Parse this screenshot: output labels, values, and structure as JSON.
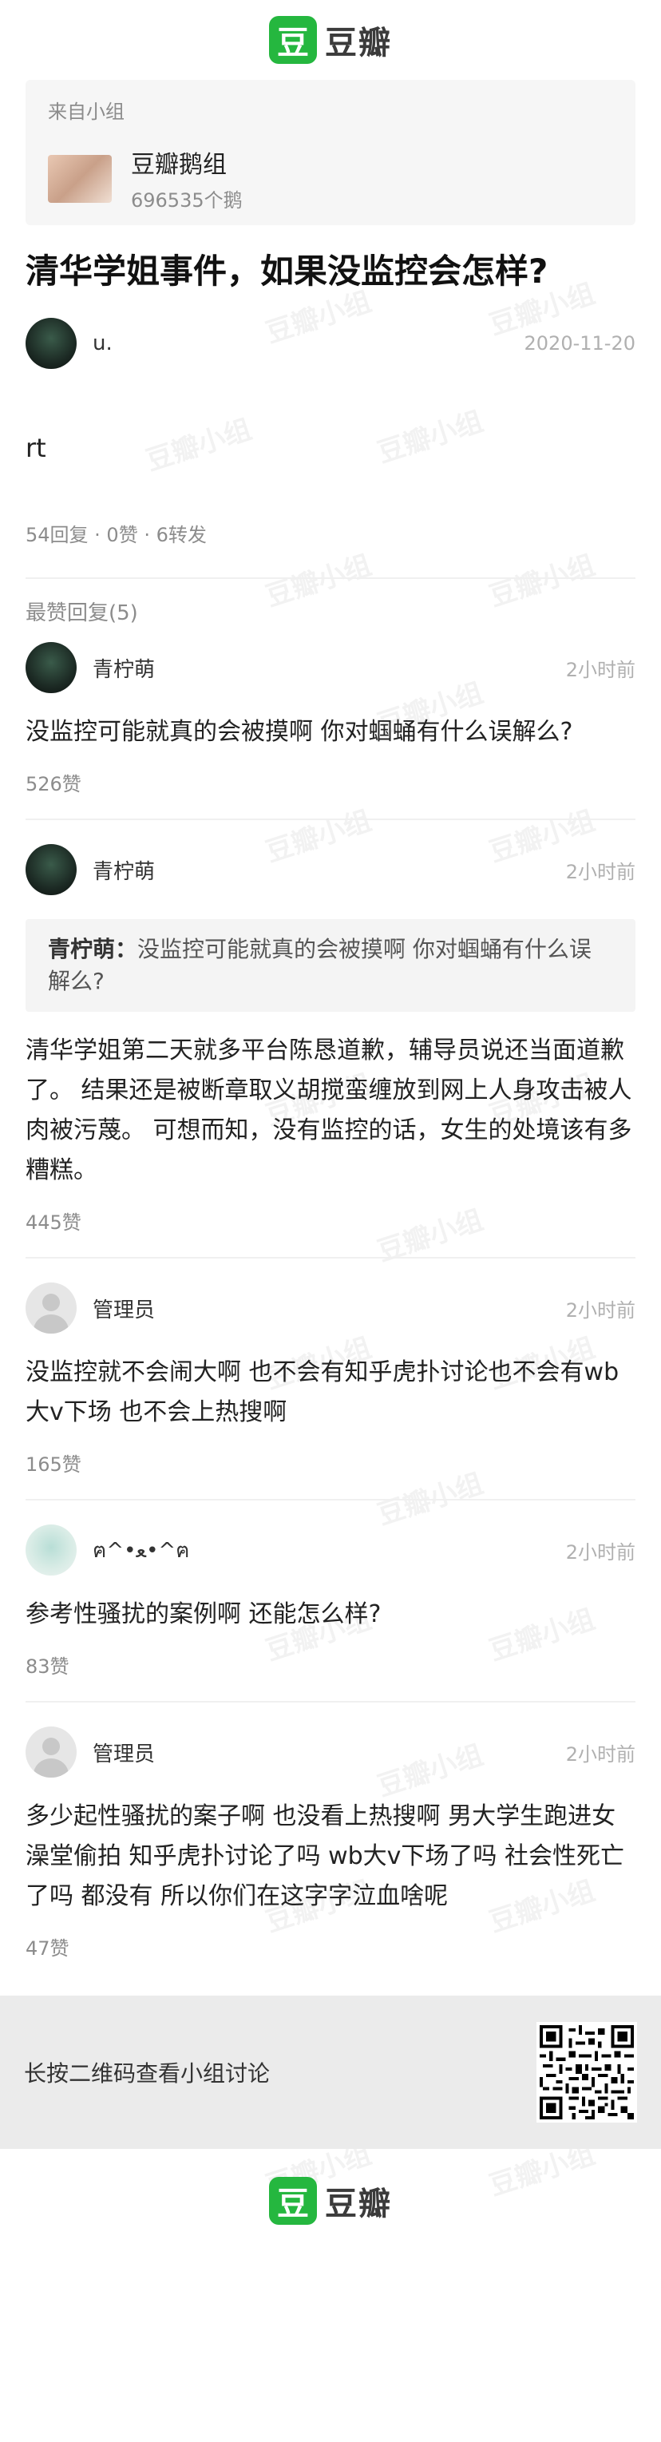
{
  "brand": {
    "logo_glyph": "豆",
    "name": "豆瓣",
    "accent": "#25b73f"
  },
  "watermark": "豆瓣小组",
  "group": {
    "from_label": "来自小组",
    "name": "豆瓣鹅组",
    "member_count": "696535个鹅"
  },
  "post": {
    "title": "清华学姐事件，如果没监控会怎样?",
    "author": "u.",
    "date": "2020-11-20",
    "body": "rt",
    "stats": "54回复 · 0赞 · 6转发"
  },
  "top_replies_label": "最赞回复(5)",
  "replies": [
    {
      "author": "青柠萌",
      "time": "2小时前",
      "text": "没监控可能就真的会被摸啊 你对蝈蛹有什么误解么?",
      "likes": "526赞"
    },
    {
      "author": "青柠萌",
      "time": "2小时前",
      "quote_author": "青柠萌：",
      "quote_text": "没监控可能就真的会被摸啊 你对蝈蛹有什么误解么?",
      "text": "清华学姐第二天就多平台陈恳道歉，辅导员说还当面道歉了。 结果还是被断章取义胡搅蛮缠放到网上人身攻击被人肉被污蔑。 可想而知，没有监控的话，女生的处境该有多糟糕。",
      "likes": "445赞"
    },
    {
      "author": "管理员",
      "time": "2小时前",
      "text": "没监控就不会闹大啊 也不会有知乎虎扑讨论也不会有wb大v下场 也不会上热搜啊",
      "likes": "165赞"
    },
    {
      "author": "ฅ^•ﻌ•^ฅ",
      "time": "2小时前",
      "text": "参考性骚扰的案例啊 还能怎么样?",
      "likes": "83赞"
    },
    {
      "author": "管理员",
      "time": "2小时前",
      "text": "多少起性骚扰的案子啊 也没看上热搜啊 男大学生跑进女澡堂偷拍 知乎虎扑讨论了吗 wb大v下场了吗 社会性死亡了吗 都没有 所以你们在这字字泣血啥呢",
      "likes": "47赞"
    }
  ],
  "footer": {
    "qr_text": "长按二维码查看小组讨论"
  }
}
